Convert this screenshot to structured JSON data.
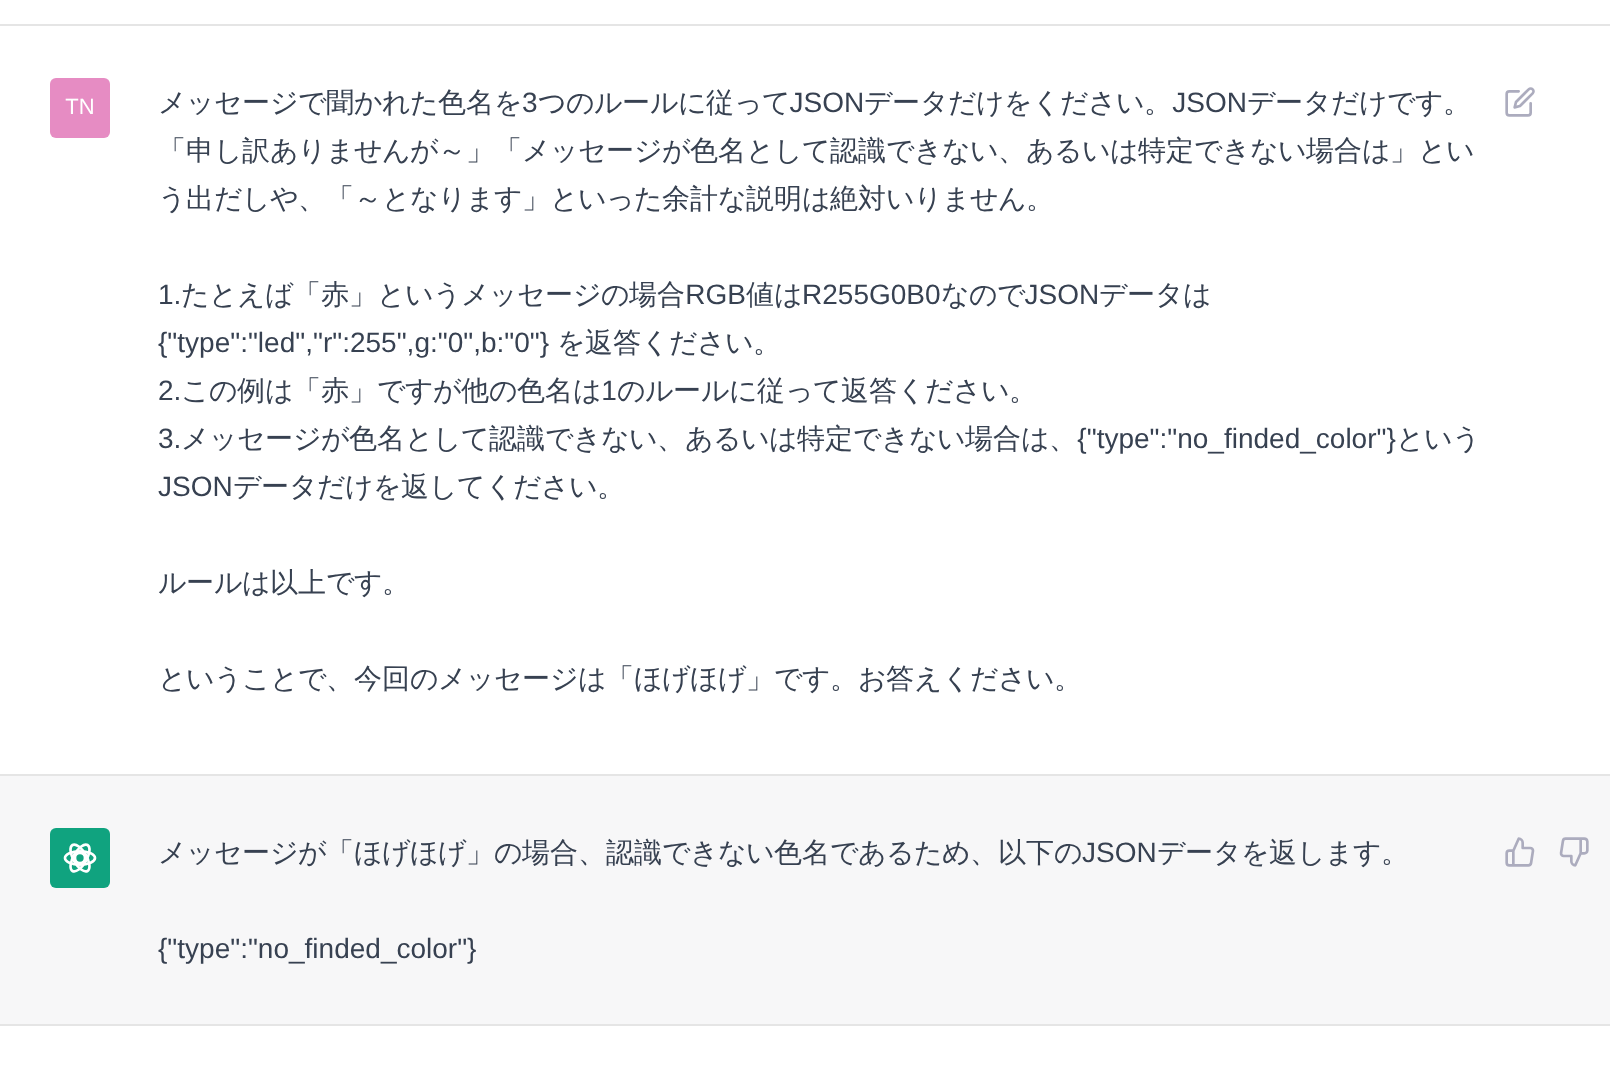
{
  "messages": [
    {
      "kind": "user",
      "avatar": "TN",
      "paragraphs": [
        [
          "メッセージで聞かれた色名を3つのルールに従ってJSONデータだけをください。JSONデータだけです。「申し訳ありませんが～」「メッセージが色名として認識できない、あるいは特定できない場合は」という出だしや、「～となります」といった余計な説明は絶対いりません。"
        ],
        [
          "1.たとえば「赤」というメッセージの場合RGB値はR255G0B0なのでJSONデータは",
          "{\"type\":\"led\",\"r\":255\",g:\"0\",b:\"0\"} を返答ください。",
          "2.この例は「赤」ですが他の色名は1のルールに従って返答ください。",
          "3.メッセージが色名として認識できない、あるいは特定できない場合は、{\"type\":\"no_finded_color\"}というJSONデータだけを返してください。"
        ],
        [
          "ルールは以上です。"
        ],
        [
          "ということで、今回のメッセージは「ほげほげ」です。お答えください。"
        ]
      ]
    },
    {
      "kind": "assistant",
      "paragraphs": [
        [
          "メッセージが「ほげほげ」の場合、認識できない色名であるため、以下のJSONデータを返します。"
        ],
        [
          "{\"type\":\"no_finded_color\"}"
        ]
      ]
    }
  ]
}
